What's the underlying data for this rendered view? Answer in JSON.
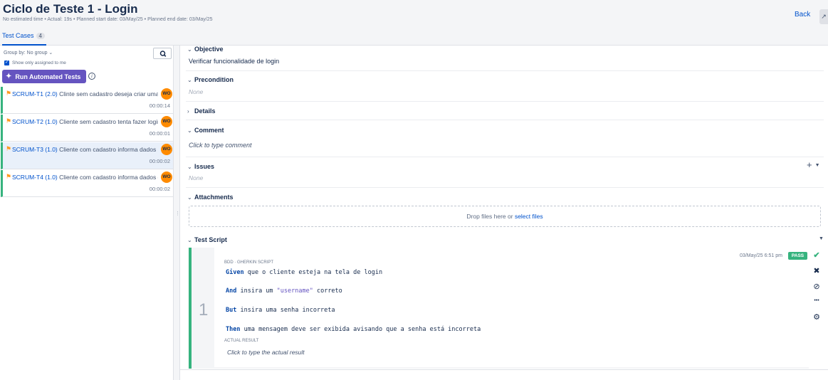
{
  "header": {
    "title": "Ciclo de Teste 1 - Login",
    "meta": "No estimated time  •  Actual: 19s  •  Planned start date: 03/May/25  •  Planned end date: 03/May/25",
    "back_label": "Back",
    "corner_label": "↗"
  },
  "tabs": {
    "test_cases_label": "Test Cases",
    "test_cases_count": "4"
  },
  "left": {
    "group_by": "Group by: No group ⌄",
    "show_only_assigned": "Show only assigned to me",
    "run_automated_label": "Run Automated Tests",
    "test_cases": [
      {
        "key": "SCRUM-T1 (2.0)",
        "summary": " Clinte sem cadastro deseja criar uma conta",
        "avatar": "WO",
        "time": "00:00:14"
      },
      {
        "key": "SCRUM-T2 (1.0)",
        "summary": " Cliente sem cadastro tenta fazer login",
        "avatar": "WO",
        "time": "00:00:01"
      },
      {
        "key": "SCRUM-T3 (1.0)",
        "summary": " Cliente com cadastro informa dados incorretos",
        "avatar": "WO",
        "time": "00:00:02"
      },
      {
        "key": "SCRUM-T4 (1.0)",
        "summary": " Cliente com cadastro informa dados corretos",
        "avatar": "WO",
        "time": "00:00:02"
      }
    ]
  },
  "detail": {
    "objective_title": "Objective",
    "objective_value": "Verificar funcionalidade de login",
    "precondition_title": "Precondition",
    "precondition_value": "None",
    "details_title": "Details",
    "comment_title": "Comment",
    "comment_placeholder": "Click to type comment",
    "issues_title": "Issues",
    "issues_value": "None",
    "attachments_title": "Attachments",
    "drop_text": "Drop files here or ",
    "select_files": "select files",
    "test_script_title": "Test Script"
  },
  "step": {
    "number": "1",
    "timestamp": "03/May/25 6:51 pm",
    "status": "PASS",
    "script_label": "BDD · GHERKIN SCRIPT",
    "lines": [
      {
        "kw": "Given",
        "pre": " que o cliente esteja na tela de login",
        "str": "",
        "post": ""
      },
      {
        "kw": "And",
        "pre": " insira um ",
        "str": "\"username\"",
        "post": " correto"
      },
      {
        "kw": "But",
        "pre": " insira uma senha incorreta",
        "str": "",
        "post": ""
      },
      {
        "kw": "Then",
        "pre": " uma mensagem deve ser exibida avisando que a senha está incorreta",
        "str": "",
        "post": ""
      }
    ],
    "actual_label": "ACTUAL RESULT",
    "actual_placeholder": "Click to type the actual result"
  },
  "icons": {
    "pass": "✔",
    "fail": "✖",
    "blocked": "⊘",
    "more": "•••",
    "settings": "⚙"
  },
  "colors": {
    "accent": "#0052cc",
    "pass": "#36b37e",
    "run_button": "#6554c0",
    "flag": "#ff991f",
    "avatar": "#ff8b00"
  }
}
